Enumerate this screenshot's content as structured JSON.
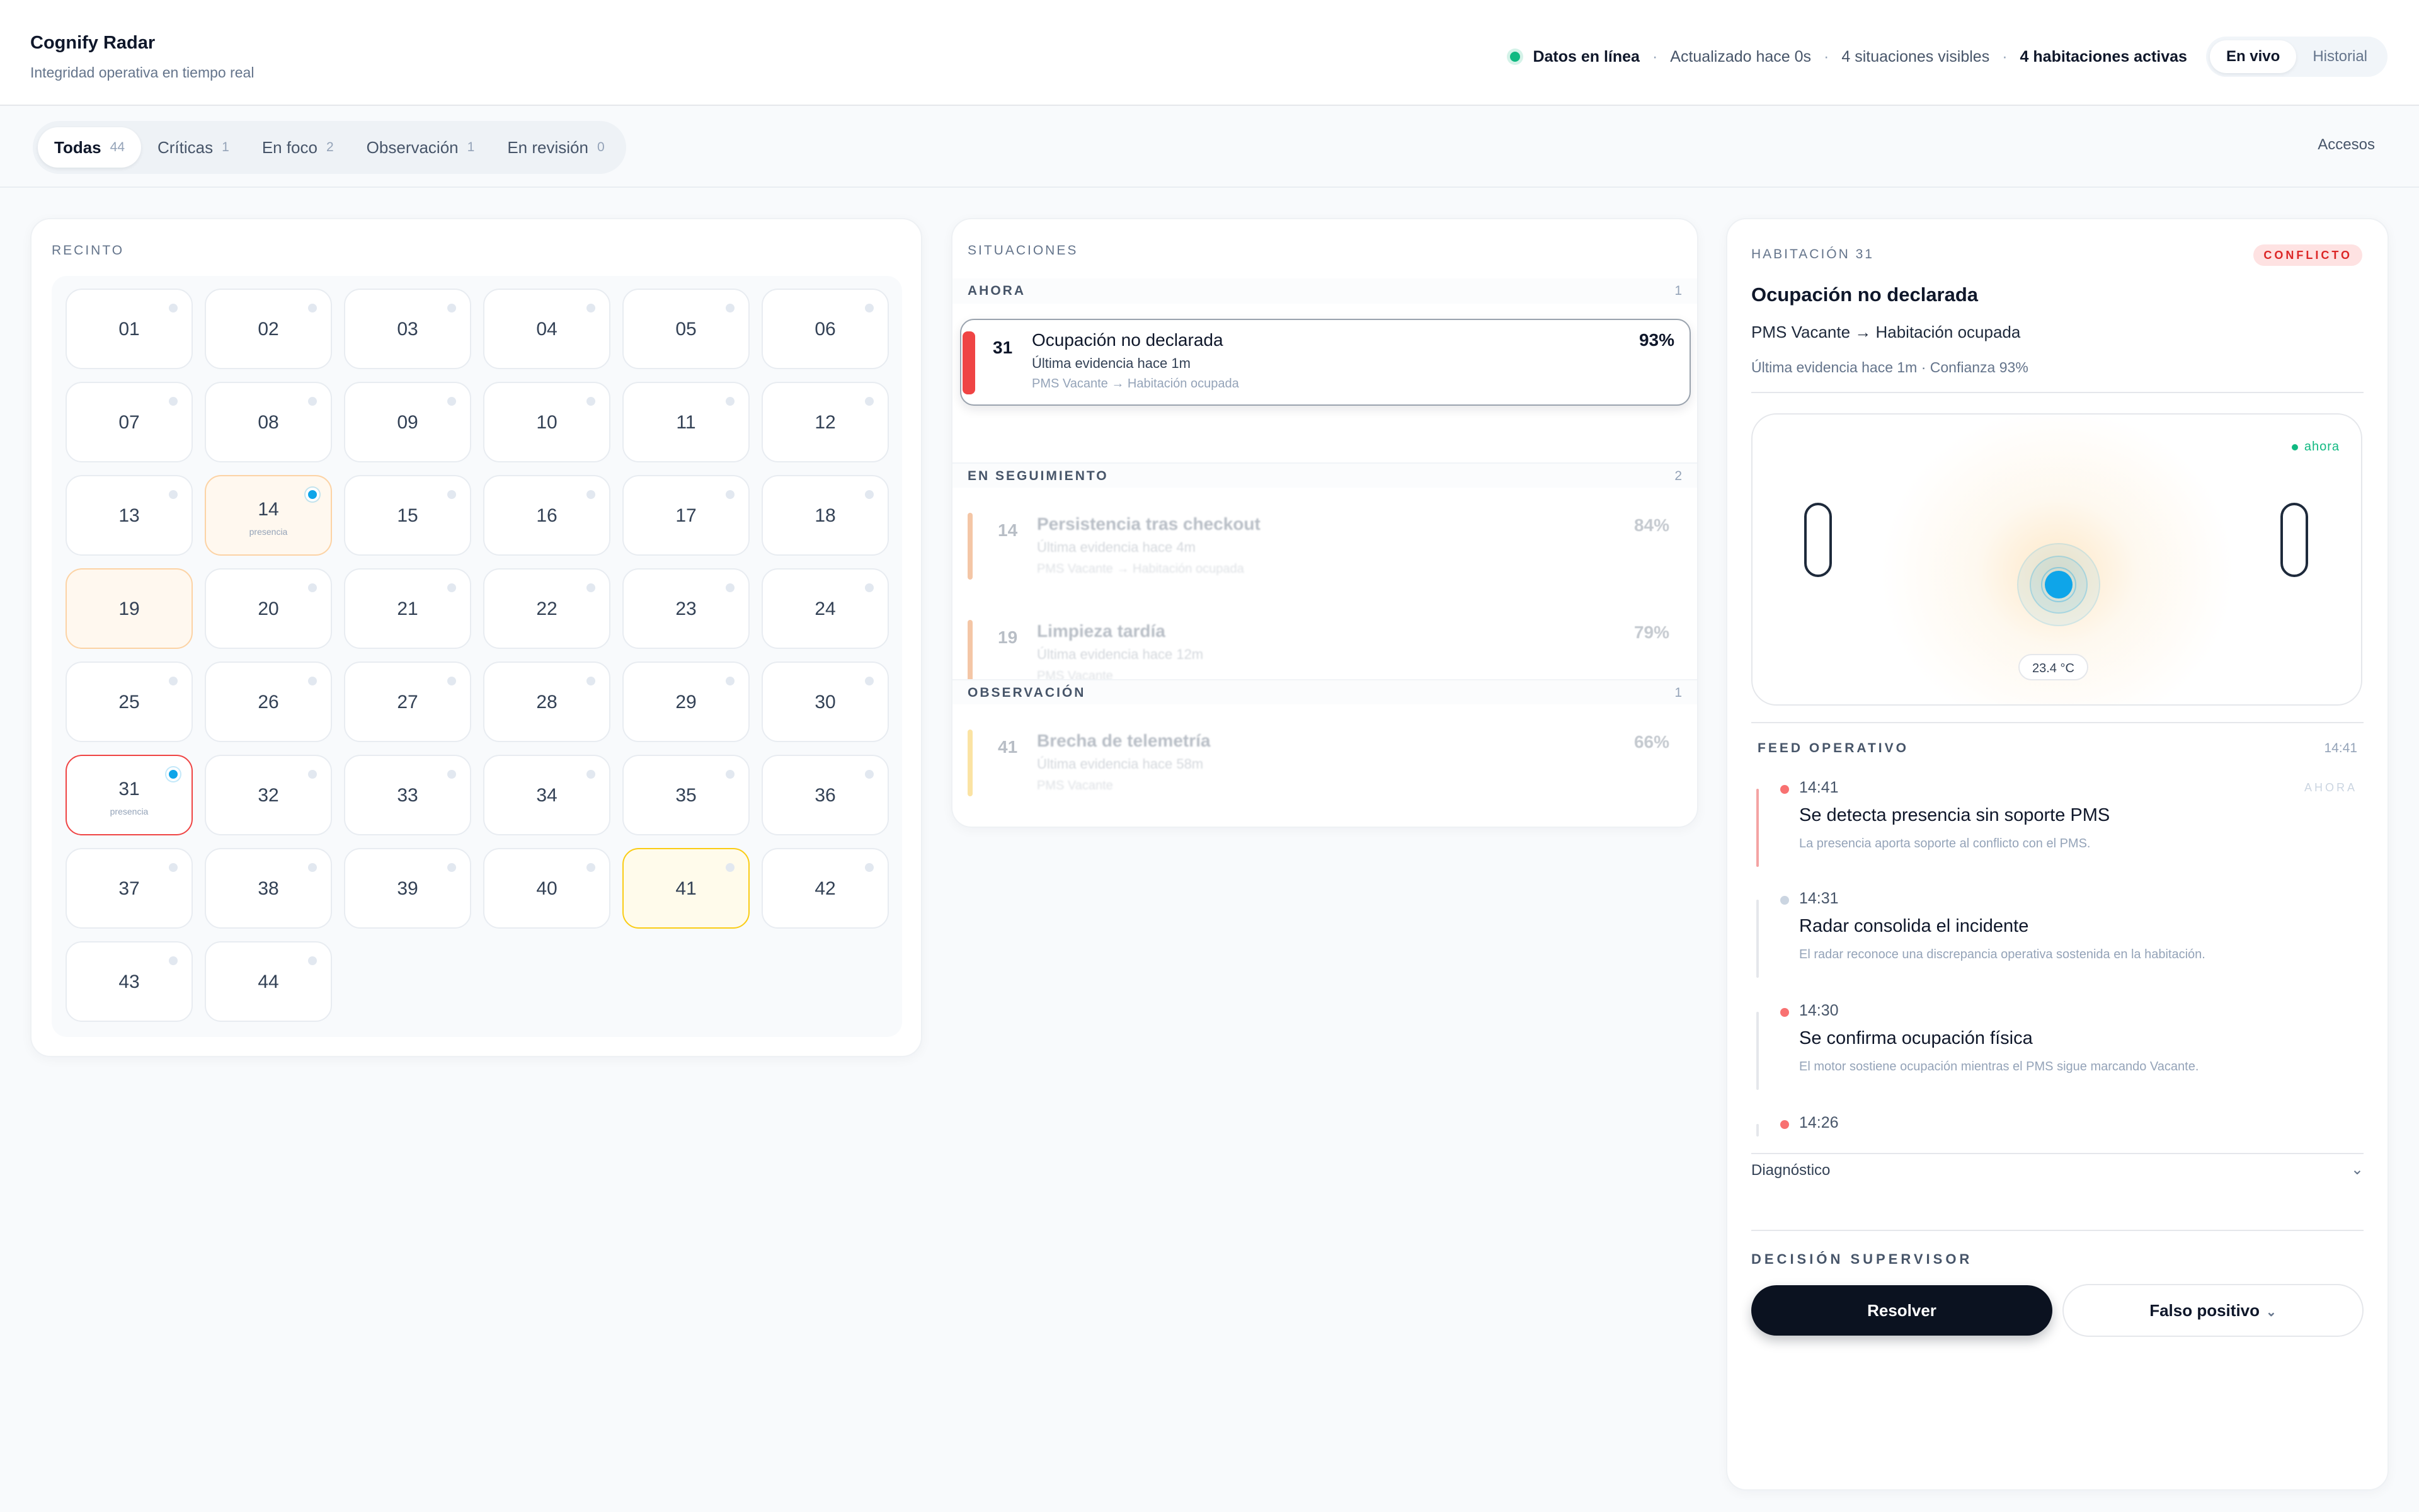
{
  "app": {
    "title": "Cognify Radar",
    "subtitle": "Integridad operativa en tiempo real"
  },
  "status": {
    "online": "Datos en línea",
    "updated": "Actualizado hace 0s",
    "visible": "4 situaciones visibles",
    "active_rooms": "4 habitaciones activas",
    "sep": "·",
    "online_color": "#10b981"
  },
  "view_toggle": {
    "live": "En vivo",
    "history": "Historial",
    "selected": "En vivo"
  },
  "filters": {
    "tabs": [
      {
        "label": "Todas",
        "count": "44"
      },
      {
        "label": "Críticas",
        "count": "1"
      },
      {
        "label": "En foco",
        "count": "2"
      },
      {
        "label": "Observación",
        "count": "1"
      },
      {
        "label": "En revisión",
        "count": "0"
      }
    ],
    "selected": "Todas",
    "access": "Accesos"
  },
  "recinto": {
    "label": "RECINTO",
    "rooms": [
      {
        "num": "01"
      },
      {
        "num": "02"
      },
      {
        "num": "03"
      },
      {
        "num": "04"
      },
      {
        "num": "05"
      },
      {
        "num": "06"
      },
      {
        "num": "07"
      },
      {
        "num": "08"
      },
      {
        "num": "09"
      },
      {
        "num": "10"
      },
      {
        "num": "11"
      },
      {
        "num": "12"
      },
      {
        "num": "13"
      },
      {
        "num": "14",
        "sub": "presencia",
        "state": "warning",
        "presence": true
      },
      {
        "num": "15"
      },
      {
        "num": "16"
      },
      {
        "num": "17"
      },
      {
        "num": "18"
      },
      {
        "num": "19",
        "state": "warning"
      },
      {
        "num": "20"
      },
      {
        "num": "21"
      },
      {
        "num": "22"
      },
      {
        "num": "23"
      },
      {
        "num": "24"
      },
      {
        "num": "25"
      },
      {
        "num": "26"
      },
      {
        "num": "27"
      },
      {
        "num": "28"
      },
      {
        "num": "29"
      },
      {
        "num": "30"
      },
      {
        "num": "31",
        "sub": "presencia",
        "state": "critical",
        "presence": true
      },
      {
        "num": "32"
      },
      {
        "num": "33"
      },
      {
        "num": "34"
      },
      {
        "num": "35"
      },
      {
        "num": "36"
      },
      {
        "num": "37"
      },
      {
        "num": "38"
      },
      {
        "num": "39"
      },
      {
        "num": "40"
      },
      {
        "num": "41",
        "state": "observation"
      },
      {
        "num": "42"
      },
      {
        "num": "43"
      },
      {
        "num": "44"
      }
    ]
  },
  "situaciones": {
    "label": "SITUACIONES",
    "groups": [
      {
        "label": "AHORA",
        "count": "1",
        "items": [
          {
            "room": "31",
            "title": "Ocupación no declarada",
            "evidence": "Última evidencia hace 1m",
            "pms": "PMS Vacante → Habitación ocupada",
            "pct": "93%",
            "color": "#ef4444",
            "selected": true
          }
        ]
      },
      {
        "label": "EN SEGUIMIENTO",
        "count": "2",
        "items": [
          {
            "room": "14",
            "title": "Persistencia tras checkout",
            "evidence": "Última evidencia hace 4m",
            "pms": "PMS Vacante → Habitación ocupada",
            "pct": "84%",
            "color": "#f4c6a6"
          },
          {
            "room": "19",
            "title": "Limpieza tardía",
            "evidence": "Última evidencia hace 12m",
            "pms": "PMS Vacante",
            "pct": "79%",
            "color": "#f4c6a6"
          }
        ]
      },
      {
        "label": "OBSERVACIÓN",
        "count": "1",
        "items": [
          {
            "room": "41",
            "title": "Brecha de telemetría",
            "evidence": "Última evidencia hace 58m",
            "pms": "PMS Vacante",
            "pct": "66%",
            "color": "#fbe3a3"
          }
        ]
      }
    ]
  },
  "detail": {
    "eyebrow": "HABITACIÓN 31",
    "badge": "CONFLICTO",
    "title": "Ocupación no declarada",
    "pms": "PMS Vacante → Habitación ocupada",
    "meta": "Última evidencia hace 1m · Confianza 93%",
    "radar": {
      "now": "ahora",
      "temp": "23.4 °C"
    },
    "feed": {
      "label": "FEED OPERATIVO",
      "time": "14:41",
      "items": [
        {
          "time": "14:41",
          "title": "Se detecta presencia sin soporte PMS",
          "desc": "La presencia aporta soporte al conflicto con el PMS.",
          "tag": "AHORA",
          "color": "#f87171",
          "rail": "#f4a3a3"
        },
        {
          "time": "14:31",
          "title": "Radar consolida el incidente",
          "desc": "El radar reconoce una discrepancia operativa sostenida en la habitación.",
          "tag": "",
          "color": "#cbd5e1",
          "rail": "#e5e7eb"
        },
        {
          "time": "14:30",
          "title": "Se confirma ocupación física",
          "desc": "El motor sostiene ocupación mientras el PMS sigue marcando Vacante.",
          "tag": "",
          "color": "#f87171",
          "rail": "#e5e7eb"
        },
        {
          "time": "14:26",
          "title": "",
          "desc": "",
          "tag": "",
          "color": "#f87171",
          "rail": "#e5e7eb"
        }
      ]
    },
    "diagnostic": "Diagnóstico",
    "decision": {
      "label": "DECISIÓN SUPERVISOR",
      "resolve": "Resolver",
      "false_positive": "Falso positivo"
    }
  }
}
